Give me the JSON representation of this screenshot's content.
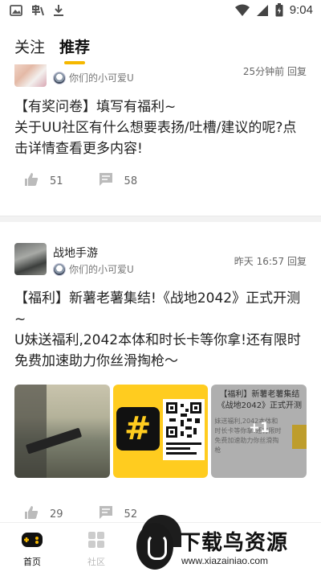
{
  "status_bar": {
    "time": "9:04"
  },
  "top_tabs": [
    {
      "label": "关注"
    },
    {
      "label": "推荐"
    }
  ],
  "accent_color": "#f5b800",
  "posts": [
    {
      "author": "你们的小可爱U",
      "meta": "25分钟前 回复",
      "body": "【有奖问卷】填写有福利~\n关于UU社区有什么想要表扬/吐槽/建议的呢?点击详情查看更多内容!",
      "likes": "51",
      "comments": "58"
    },
    {
      "group": "战地手游",
      "author": "你们的小可爱U",
      "meta": "昨天 16:57 回复",
      "body": "【福利】新薯老薯集结!《战地2042》正式开测~\nU妹送福利,2042本体和时长卡等你拿!还有限时免费加速助力你丝滑掏枪〜",
      "likes": "29",
      "comments": "52",
      "image3": {
        "title": "【福利】新薯老薯集结\n《战地2042》正式开测",
        "body": "妹送福利,2042本体和时长卡等你拿!还有限时免费加速助力你丝滑掏枪",
        "more": "+1"
      }
    }
  ],
  "bottom_nav": [
    {
      "label": "首页"
    },
    {
      "label": "社区"
    }
  ],
  "watermark": {
    "title": "下载鸟资源",
    "url": "www.xiazainiao.com"
  }
}
